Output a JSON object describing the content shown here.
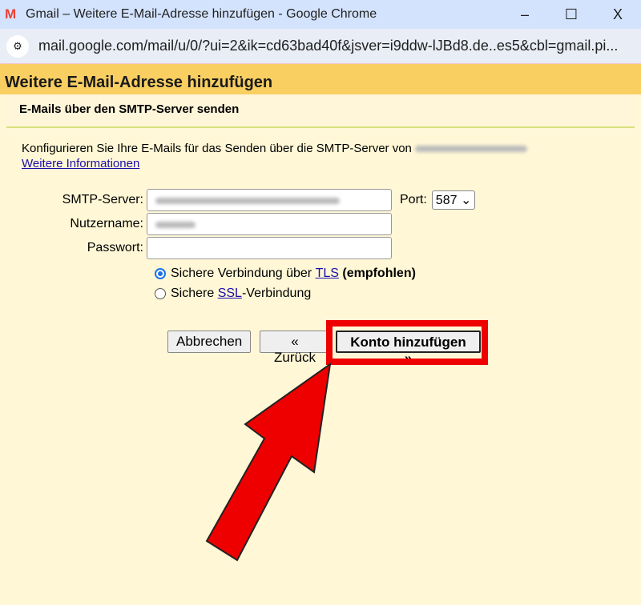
{
  "window": {
    "title": "Gmail – Weitere E-Mail-Adresse hinzufügen - Google Chrome",
    "url": "mail.google.com/mail/u/0/?ui=2&ik=cd63bad40f&jsver=i9ddw-lJBd8.de..es5&cbl=gmail.pi...",
    "minimize": "–",
    "maximize": "☐",
    "close": "X"
  },
  "header": {
    "title": "Weitere E-Mail-Adresse hinzufügen",
    "subtitle": "E-Mails über den SMTP-Server senden"
  },
  "intro": {
    "text": "Konfigurieren Sie Ihre E-Mails für das Senden über die SMTP-Server von",
    "link": "Weitere Informationen"
  },
  "form": {
    "smtp_label": "SMTP-Server:",
    "port_label": "Port:",
    "port_value": "587",
    "user_label": "Nutzername:",
    "pass_label": "Passwort:"
  },
  "options": {
    "tls_prefix": "Sichere Verbindung über ",
    "tls_link": "TLS",
    "tls_suffix": "(empfohlen)",
    "ssl_prefix": "Sichere ",
    "ssl_link": "SSL",
    "ssl_suffix": "-Verbindung"
  },
  "buttons": {
    "cancel": "Abbrechen",
    "back": "« Zurück",
    "add": "Konto hinzufügen »"
  },
  "colors": {
    "highlight": "#ee0000",
    "header": "#f9cf62"
  }
}
